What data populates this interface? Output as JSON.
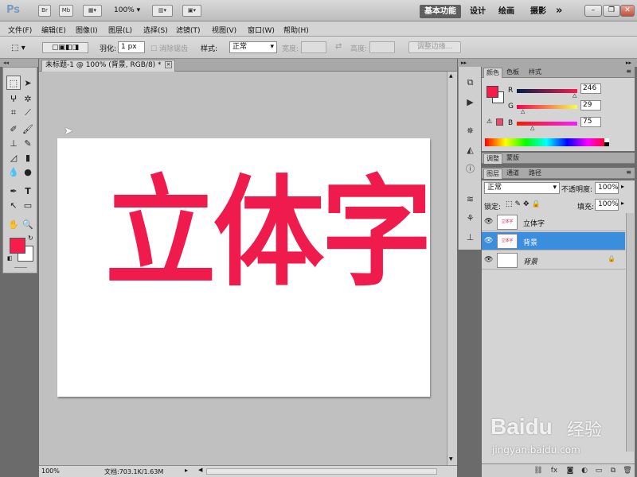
{
  "app": {
    "logo": "Ps",
    "bridge": "Br",
    "minibridge": "Mb",
    "zoom": "100%",
    "workspaces": [
      "基本功能",
      "设计",
      "绘画",
      "摄影"
    ],
    "more": "»"
  },
  "menu": [
    "文件(F)",
    "编辑(E)",
    "图像(I)",
    "图层(L)",
    "选择(S)",
    "滤镜(T)",
    "视图(V)",
    "窗口(W)",
    "帮助(H)"
  ],
  "options": {
    "feather_label": "羽化:",
    "feather_value": "1 px",
    "antialias_label": "消除锯齿",
    "style_label": "样式:",
    "style_value": "正常",
    "width_label": "宽度:",
    "height_label": "高度:",
    "refine_button": "调整边缘..."
  },
  "document": {
    "tab_title": "未标题-1 @ 100% (背景, RGB/8) *",
    "text_content": "立体字"
  },
  "status": {
    "zoom": "100%",
    "doc_info": "文档:703.1K/1.63M"
  },
  "color_panel": {
    "tabs": [
      "颜色",
      "色板",
      "样式"
    ],
    "r_label": "R",
    "g_label": "G",
    "b_label": "B",
    "r": 246,
    "g": 29,
    "b": 75,
    "fg": "#f61d4b"
  },
  "adjust_tabs": [
    "调整",
    "蒙版"
  ],
  "layers_panel": {
    "tabs": [
      "图层",
      "通道",
      "路径"
    ],
    "blend_mode": "正常",
    "opacity_label": "不透明度:",
    "opacity": "100%",
    "lock_label": "锁定:",
    "fill_label": "填充:",
    "fill": "100%",
    "layers": [
      {
        "name": "立体字",
        "thumb": "立体字"
      },
      {
        "name": "背景",
        "thumb": "立体字"
      },
      {
        "name": "背景",
        "thumb": ""
      }
    ]
  },
  "watermark": {
    "brand": "Baidu",
    "cn": "经验",
    "url": "jingyan.baidu.com"
  }
}
